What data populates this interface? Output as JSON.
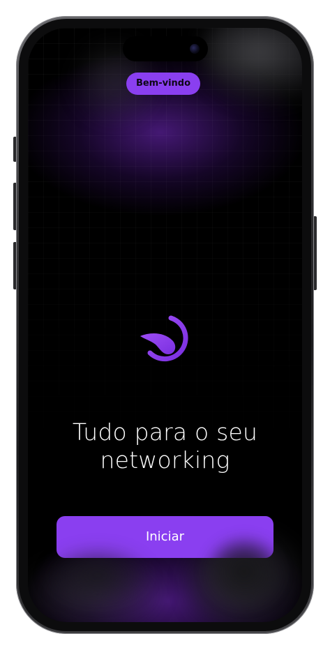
{
  "welcome_badge": {
    "label": "Bem-vindo"
  },
  "headline": {
    "line1": "Tudo para o seu",
    "line2": "networking"
  },
  "start_button": {
    "label": "Iniciar"
  },
  "logo": {
    "icon": "app-logo-icon"
  },
  "colors": {
    "accent": "#8a3ff0",
    "background": "#000000",
    "text": "#ffffff",
    "badge_text": "#0d0716"
  }
}
